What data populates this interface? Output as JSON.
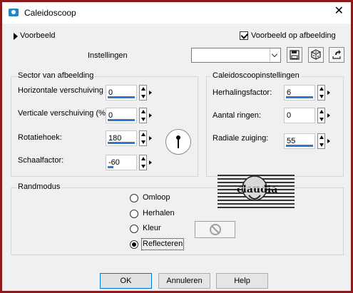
{
  "window": {
    "title": "Caleidoscoop"
  },
  "preview": {
    "label": "Voorbeeld",
    "checkbox_label": "Voorbeeld op afbeelding",
    "checked": true
  },
  "settings": {
    "label": "Instellingen",
    "preset_value": ""
  },
  "sector_group": {
    "title": "Sector van afbeelding",
    "fields": [
      {
        "label": "Horizontale verschuiving (%):",
        "value": "0"
      },
      {
        "label": "Verticale verschuiving (%):",
        "value": "0"
      },
      {
        "label": "Rotatiehoek:",
        "value": "180"
      },
      {
        "label": "Schaalfactor:",
        "value": "-60"
      }
    ]
  },
  "kaleido_group": {
    "title": "Caleidoscoopinstellingen",
    "fields": [
      {
        "label": "Herhalingsfactor:",
        "value": "6"
      },
      {
        "label": "Aantal ringen:",
        "value": "0"
      },
      {
        "label": "Radiale zuiging:",
        "value": "55"
      }
    ]
  },
  "edge_mode": {
    "title": "Randmodus",
    "options": [
      {
        "label": "Omloop",
        "selected": false
      },
      {
        "label": "Herhalen",
        "selected": false
      },
      {
        "label": "Kleur",
        "selected": false
      },
      {
        "label": "Reflecteren",
        "selected": true
      }
    ]
  },
  "watermark": {
    "text": "claudia"
  },
  "buttons": {
    "ok": "OK",
    "cancel": "Annuleren",
    "help": "Help"
  },
  "colors": {
    "frame": "#8c1a1a",
    "accent": "#2d7ad1",
    "title_icon": "#1f86c8"
  }
}
